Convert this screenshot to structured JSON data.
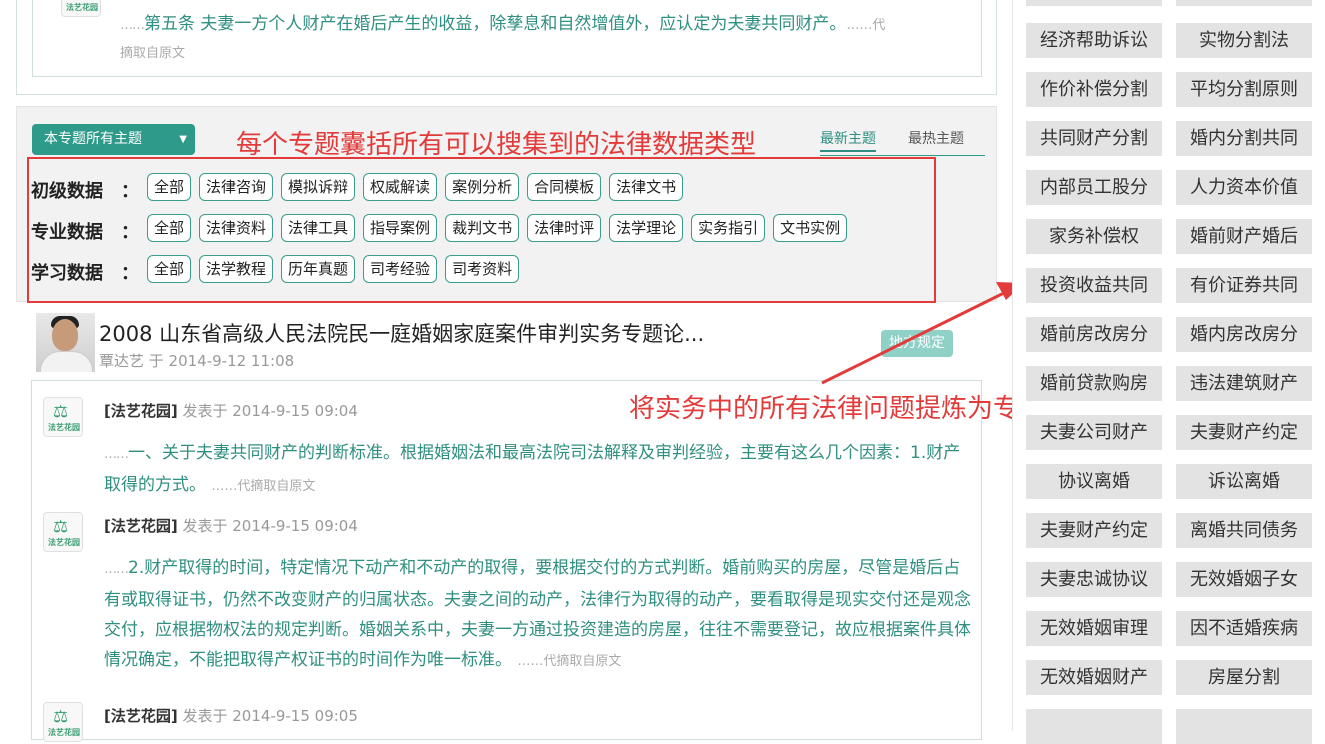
{
  "top_card": {
    "excerpt": "第五条 夫妻一方个人财产在婚后产生的收益，除孳息和自然增值外，应认定为夫妻共同财产。",
    "dots": "……",
    "more_1": "……代",
    "more_2": "摘取自原文",
    "logo_brand": "法艺花园"
  },
  "filter": {
    "dropdown_label": "本专题所有主题",
    "tab_latest": "最新主题",
    "tab_hottest": "最热主题",
    "rows": [
      {
        "label": "初级数据",
        "colon": "：",
        "items": [
          "全部",
          "法律咨询",
          "模拟诉辩",
          "权威解读",
          "案例分析",
          "合同模板",
          "法律文书"
        ]
      },
      {
        "label": "专业数据",
        "colon": "：",
        "items": [
          "全部",
          "法律资料",
          "法律工具",
          "指导案例",
          "裁判文书",
          "法律时评",
          "法学理论",
          "实务指引",
          "文书实例"
        ]
      },
      {
        "label": "学习数据",
        "colon": "：",
        "items": [
          "全部",
          "法学教程",
          "历年真题",
          "司考经验",
          "司考资料"
        ]
      }
    ]
  },
  "annotations": {
    "filter_note": "每个专题囊括所有可以搜集到的法律数据类型",
    "topic_note": "将实务中的所有法律问题提炼为专题"
  },
  "post": {
    "title": "2008 山东省高级人民法院民一庭婚姻家庭案件审判实务专题论...",
    "author_line": "覃达艺 于 2014-9-12 11:08",
    "badge": "地方规定"
  },
  "replies": [
    {
      "source": "[法艺花园]",
      "timestamp": "发表于 2014-9-15 09:04",
      "body": "一、关于夫妻共同财产的判断标准。根据婚姻法和最高法院司法解释及审判经验，主要有这么几个因素：1.财产取得的方式。",
      "more": "……代摘取自原文"
    },
    {
      "source": "[法艺花园]",
      "timestamp": "发表于 2014-9-15 09:04",
      "body": "2.财产取得的时间，特定情况下动产和不动产的取得，要根据交付的方式判断。婚前购买的房屋，尽管是婚后占有或取得证书，仍然不改变财产的归属状态。夫妻之间的动产，法律行为取得的动产，要看取得是现实交付还是观念交付，应根据物权法的规定判断。婚姻关系中，夫妻一方通过投资建造的房屋，往往不需要登记，故应根据案件具体情况确定，不能把取得产权证书的时间作为唯一标准。",
      "more": "……代摘取自原文"
    },
    {
      "source": "[法艺花园]",
      "timestamp": "发表于 2014-9-15 09:05",
      "body": "",
      "more": ""
    }
  ],
  "sidebar_tags": [
    [
      "经济帮助诉讼",
      "实物分割法"
    ],
    [
      "作价补偿分割",
      "平均分割原则"
    ],
    [
      "共同财产分割",
      "婚内分割共同"
    ],
    [
      "内部员工股分",
      "人力资本价值"
    ],
    [
      "家务补偿权",
      "婚前财产婚后"
    ],
    [
      "投资收益共同",
      "有价证券共同"
    ],
    [
      "婚前房改房分",
      "婚内房改房分"
    ],
    [
      "婚前贷款购房",
      "违法建筑财产"
    ],
    [
      "夫妻公司财产",
      "夫妻财产约定"
    ],
    [
      "协议离婚",
      "诉讼离婚"
    ],
    [
      "夫妻财产约定",
      "离婚共同债务"
    ],
    [
      "夫妻忠诚协议",
      "无效婚姻子女"
    ],
    [
      "无效婚姻审理",
      "因不适婚疾病"
    ],
    [
      "无效婚姻财产",
      "房屋分割"
    ]
  ],
  "colors": {
    "accent": "#2e9a8a",
    "annotation_red": "#e33a3a",
    "tag_bg": "#e3e3e3"
  }
}
